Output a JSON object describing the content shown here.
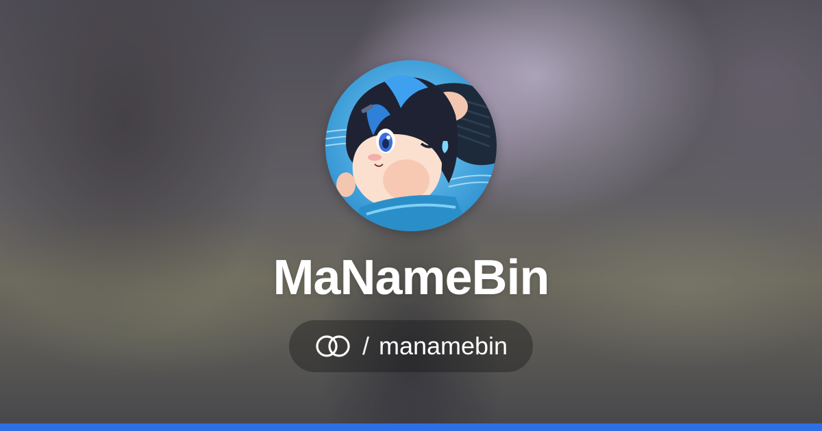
{
  "profile": {
    "display_name": "MaNameBin",
    "separator": "/",
    "username": "manamebin",
    "avatar_icon": "anime-character-avatar",
    "platform_icon": "linked-rings-logo-icon"
  },
  "colors": {
    "accent_bar": "#2f6fe6",
    "title_text": "#ffffff",
    "pill_background": "rgba(20,20,22,0.38)"
  }
}
